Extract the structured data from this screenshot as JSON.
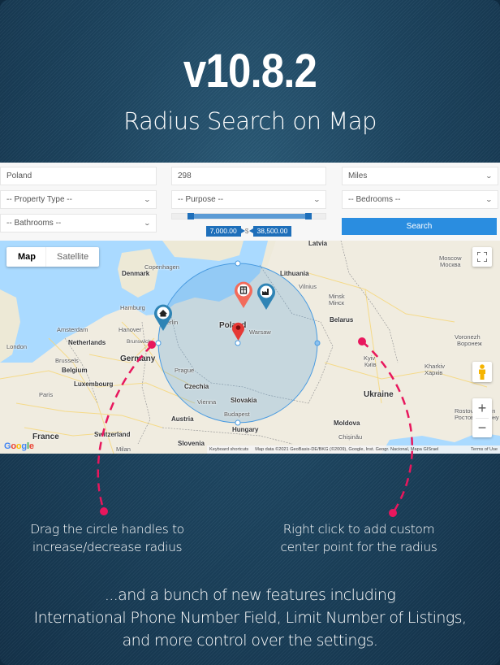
{
  "hero": {
    "version": "v10.8.2",
    "subtitle": "Radius Search on Map"
  },
  "search_form": {
    "location_value": "Poland",
    "radius_value": "298",
    "unit_selected": "Miles",
    "property_type_selected": "-- Property Type --",
    "purpose_selected": "-- Purpose --",
    "bedrooms_selected": "-- Bedrooms --",
    "bathrooms_selected": "-- Bathrooms --",
    "price_min": "7,000.00",
    "price_max": "38,500.00",
    "price_min_fraction": 0.1,
    "price_max_fraction": 0.9,
    "currency_symbol": "$",
    "search_label": "Search",
    "accent_color": "#2a8de0"
  },
  "map": {
    "type_options": [
      "Map",
      "Satellite"
    ],
    "type_selected": "Map",
    "fullscreen_icon": "fullscreen-icon",
    "pegman_icon": "street-view-pegman-icon",
    "zoom_in_label": "+",
    "zoom_out_label": "−",
    "google_logo": "Google",
    "attribution": {
      "shortcuts": "Keyboard shortcuts",
      "data": "Map data ©2021 GeoBasis-DE/BKG (©2009), Google, Inst. Geogr. Nacional, Mapa GISrael",
      "terms": "Terms of Use"
    },
    "labels": {
      "latvia": "Latvia",
      "denmark": "Denmark",
      "copenhagen": "Copenhagen",
      "lithuania": "Lithuania",
      "vilnius": "Vilnius",
      "moscow": "Moscow",
      "moscow_ru": "Москва",
      "hamburg": "Hamburg",
      "amsterdam": "Amsterdam",
      "netherlands": "Netherlands",
      "hanover": "Hanover",
      "brunswick": "Brunswick",
      "berlin": "Berlin",
      "poland": "Poland",
      "warsaw": "Warsaw",
      "minsk": "Minsk",
      "minsk_ru": "Мінск",
      "belarus": "Belarus",
      "london": "London",
      "brussels": "Brussels",
      "belgium": "Belgium",
      "germany": "Germany",
      "luxembourg": "Luxembourg",
      "prague": "Prague",
      "czechia": "Czechia",
      "paris": "Paris",
      "voronezh": "Voronezh",
      "voronezh_ru": "Воронеж",
      "kyiv": "Kyiv",
      "kyiv_ua": "Київ",
      "kharkiv": "Kharkiv",
      "kharkiv_ua": "Харків",
      "vienna": "Vienna",
      "slovakia": "Slovakia",
      "ukraine": "Ukraine",
      "budapest": "Budapest",
      "austria": "Austria",
      "hungary": "Hungary",
      "switzerland": "Switzerland",
      "france": "France",
      "slovenia": "Slovenia",
      "milan": "Milan",
      "moldova": "Moldova",
      "chisinau": "Chișinău",
      "rostov": "Rostov-on-Don",
      "rostov_ru": "Ростов-на-Дону"
    },
    "markers": [
      {
        "name": "house-marker",
        "icon": "house-icon",
        "color": "#2f84b5"
      },
      {
        "name": "office-marker",
        "icon": "building-icon",
        "color": "#f26b5b"
      },
      {
        "name": "factory-marker",
        "icon": "factory-icon",
        "color": "#2f84b5"
      },
      {
        "name": "center-marker",
        "icon": "pin-icon",
        "color": "#e53935"
      }
    ],
    "radius_circle_color": "#4a9be0"
  },
  "annotations": {
    "left": "Drag the circle handles to\nincrease/decrease radius",
    "left_line1": "Drag the circle handles to",
    "left_line2": "increase/decrease radius",
    "right_line1": "Right click to add custom",
    "right_line2": "center point for the radius",
    "callout_color": "#e8175d"
  },
  "footer": {
    "line1": "...and a bunch of new features including",
    "line2": "International Phone Number Field, Limit Number of Listings,",
    "line3": "and more control over the settings."
  }
}
